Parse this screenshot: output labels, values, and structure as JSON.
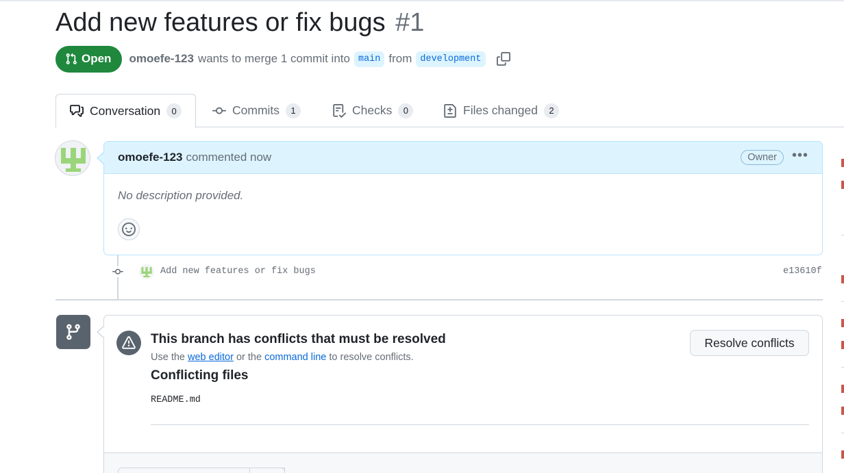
{
  "pr": {
    "title": "Add new features or fix bugs",
    "number": "#1",
    "state": "Open",
    "author": "omoefe-123",
    "merge_text": "wants to merge 1 commit into",
    "base_branch": "main",
    "from_text": "from",
    "head_branch": "development"
  },
  "tabs": [
    {
      "label": "Conversation",
      "count": "0",
      "icon": "comment-discussion-icon"
    },
    {
      "label": "Commits",
      "count": "1",
      "icon": "git-commit-icon"
    },
    {
      "label": "Checks",
      "count": "0",
      "icon": "checklist-icon"
    },
    {
      "label": "Files changed",
      "count": "2",
      "icon": "file-diff-icon"
    }
  ],
  "comment": {
    "author": "omoefe-123",
    "action": "commented now",
    "role_badge": "Owner",
    "body": "No description provided."
  },
  "commit": {
    "message": "Add new features or fix bugs",
    "sha": "e13610f"
  },
  "merge": {
    "title": "This branch has conflicts that must be resolved",
    "sub_prefix": "Use the",
    "web_editor_link": "web editor",
    "sub_middle": "or the",
    "command_line_link": "command line",
    "sub_suffix": "to resolve conflicts.",
    "resolve_button": "Resolve conflicts",
    "files_heading": "Conflicting files",
    "files": [
      "README.md"
    ]
  },
  "colors": {
    "open_green": "#1f883d",
    "link_blue": "#0969da",
    "comment_header_bg": "#ddf4ff",
    "avatar_green": "#9bd57a"
  }
}
